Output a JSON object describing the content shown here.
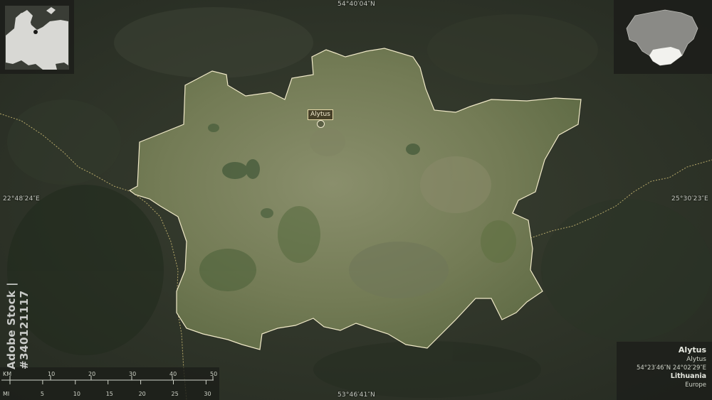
{
  "coordinates": {
    "top": "54°40′04″N",
    "bottom": "53°46′41″N",
    "left": "22°48′24″E",
    "right": "25°30′23″E"
  },
  "city": {
    "label": "Alytus"
  },
  "info": {
    "region": "Alytus",
    "admin": "Alytus",
    "coords": "54°23′46″N 24°02′29″E",
    "country": "Lithuania",
    "continent": "Europe"
  },
  "scale": {
    "km_unit": "KM",
    "mi_unit": "MI",
    "km_ticks": [
      "0",
      "10",
      "20",
      "30",
      "40",
      "50"
    ],
    "mi_ticks": [
      "0",
      "5",
      "10",
      "15",
      "20",
      "25",
      "30"
    ]
  },
  "watermark": "Adobe Stock | #340121117",
  "colors": {
    "background": "#2e3428",
    "region_fill": "#7d8560",
    "border_line": "#d8c67a",
    "highlight": "#ffffff"
  },
  "icons": {
    "city": "city-marker-icon",
    "europe_inset": "europe-locator-map",
    "country_inset": "lithuania-locator-map"
  }
}
